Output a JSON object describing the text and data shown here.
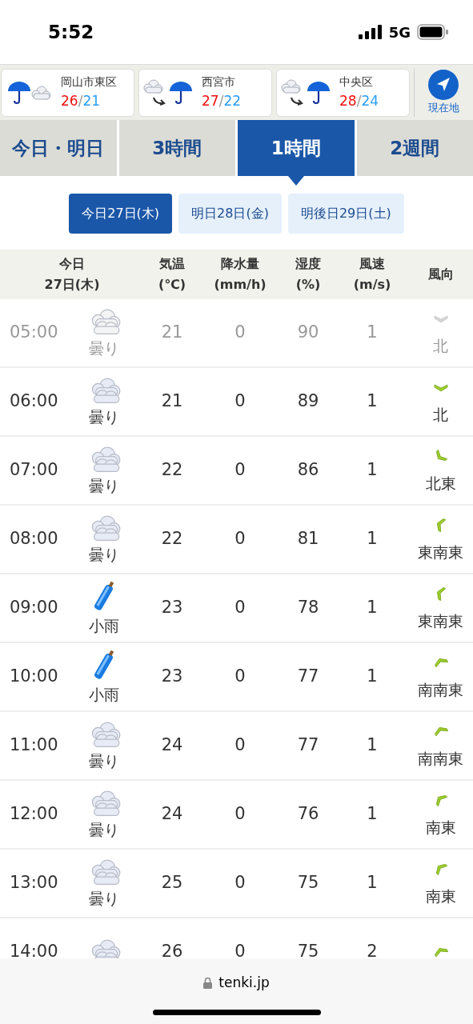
{
  "status_bar": {
    "time": "5:52",
    "network": "5G"
  },
  "locations": [
    {
      "name": "岡山市東区",
      "kind": "rain_cloud",
      "high": "26",
      "separator": "/",
      "low": "21"
    },
    {
      "name": "西宮市",
      "kind": "cloud_to_rain",
      "high": "27",
      "separator": "/",
      "low": "22"
    },
    {
      "name": "中央区",
      "kind": "cloud_to_rain",
      "high": "28",
      "separator": "/",
      "low": "24"
    }
  ],
  "current_location": {
    "label": "現在地"
  },
  "tabs": [
    {
      "label": "今日・明日",
      "selected": false
    },
    {
      "label": "3時間",
      "selected": false
    },
    {
      "label": "1時間",
      "selected": true
    },
    {
      "label": "2週間",
      "selected": false
    }
  ],
  "days": [
    {
      "label": "今日27日(木)",
      "selected": true
    },
    {
      "label": "明日28日(金)",
      "selected": false
    },
    {
      "label": "明後日29日(土)",
      "selected": false
    }
  ],
  "table": {
    "columns": [
      {
        "line1": "今日",
        "line2": "27日(木)"
      },
      {
        "line1": "気温",
        "line2": "(℃)"
      },
      {
        "line1": "降水量",
        "line2": "(mm/h)"
      },
      {
        "line1": "湿度",
        "line2": "(%)"
      },
      {
        "line1": "風速",
        "line2": "(m/s)"
      },
      {
        "line1": "風向"
      }
    ],
    "rows": [
      {
        "time": "05:00",
        "past": true,
        "weather": {
          "kind": "cloud",
          "label": "曇り"
        },
        "temp": "21",
        "precip": "0",
        "humidity": "90",
        "wind_speed": "1",
        "wind": {
          "kind": "n",
          "label": "北"
        }
      },
      {
        "time": "06:00",
        "past": false,
        "weather": {
          "kind": "cloud",
          "label": "曇り"
        },
        "temp": "21",
        "precip": "0",
        "humidity": "89",
        "wind_speed": "1",
        "wind": {
          "kind": "n",
          "label": "北"
        }
      },
      {
        "time": "07:00",
        "past": false,
        "weather": {
          "kind": "cloud",
          "label": "曇り"
        },
        "temp": "22",
        "precip": "0",
        "humidity": "86",
        "wind_speed": "1",
        "wind": {
          "kind": "ne",
          "label": "北東"
        }
      },
      {
        "time": "08:00",
        "past": false,
        "weather": {
          "kind": "cloud",
          "label": "曇り"
        },
        "temp": "22",
        "precip": "0",
        "humidity": "81",
        "wind_speed": "1",
        "wind": {
          "kind": "ese",
          "label": "東南東"
        }
      },
      {
        "time": "09:00",
        "past": false,
        "weather": {
          "kind": "rain",
          "label": "小雨"
        },
        "temp": "23",
        "precip": "0",
        "humidity": "78",
        "wind_speed": "1",
        "wind": {
          "kind": "ese",
          "label": "東南東"
        }
      },
      {
        "time": "10:00",
        "past": false,
        "weather": {
          "kind": "rain",
          "label": "小雨"
        },
        "temp": "23",
        "precip": "0",
        "humidity": "77",
        "wind_speed": "1",
        "wind": {
          "kind": "sse",
          "label": "南南東"
        }
      },
      {
        "time": "11:00",
        "past": false,
        "weather": {
          "kind": "cloud",
          "label": "曇り"
        },
        "temp": "24",
        "precip": "0",
        "humidity": "77",
        "wind_speed": "1",
        "wind": {
          "kind": "sse",
          "label": "南南東"
        }
      },
      {
        "time": "12:00",
        "past": false,
        "weather": {
          "kind": "cloud",
          "label": "曇り"
        },
        "temp": "24",
        "precip": "0",
        "humidity": "76",
        "wind_speed": "1",
        "wind": {
          "kind": "se",
          "label": "南東"
        }
      },
      {
        "time": "13:00",
        "past": false,
        "weather": {
          "kind": "cloud",
          "label": "曇り"
        },
        "temp": "25",
        "precip": "0",
        "humidity": "75",
        "wind_speed": "1",
        "wind": {
          "kind": "se",
          "label": "南東"
        }
      },
      {
        "time": "14:00",
        "past": false,
        "weather": {
          "kind": "cloud"
        },
        "temp": "26",
        "precip": "0",
        "humidity": "75",
        "wind_speed": "2",
        "wind": {
          "kind": "sse"
        }
      }
    ]
  },
  "browser": {
    "url": "tenki.jp"
  }
}
